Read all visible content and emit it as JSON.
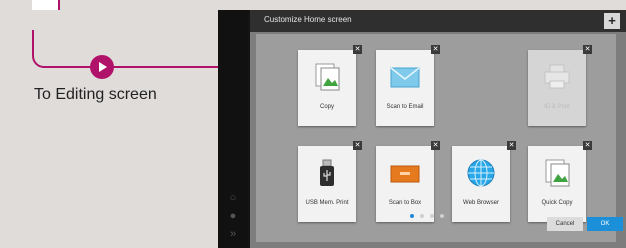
{
  "callout": {
    "label": "To Editing screen",
    "accent": "#b0126a"
  },
  "screen": {
    "title": "Customize Home screen",
    "add_label": "+",
    "delete_mark": "✕",
    "tiles": [
      {
        "label": "Copy",
        "icon": "copy-icon",
        "dim": false
      },
      {
        "label": "Scan to Email",
        "icon": "email-envelope-icon",
        "dim": false
      },
      {
        "label": "ID & Print",
        "icon": "printer-icon",
        "dim": true
      },
      {
        "label": "USB Mem. Print",
        "icon": "usb-drive-icon",
        "dim": false
      },
      {
        "label": "Scan to Box",
        "icon": "box-folder-icon",
        "dim": false
      },
      {
        "label": "Web Browser",
        "icon": "globe-icon",
        "dim": false
      },
      {
        "label": "Quick Copy",
        "icon": "quick-copy-icon",
        "dim": false
      }
    ],
    "page_dots": 4,
    "active_dot": 1,
    "cancel_label": "Cancel",
    "ok_label": "OK",
    "ok_color": "#1b8fd8"
  }
}
